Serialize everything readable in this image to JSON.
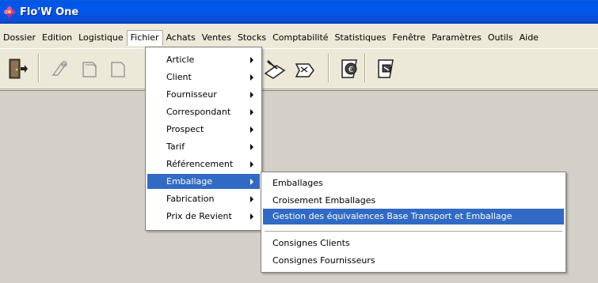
{
  "window": {
    "title": "Flo'W One",
    "app_icon": "flower-app-icon"
  },
  "menubar": {
    "items": [
      "Dossier",
      "Edition",
      "Logistique",
      "Fichier",
      "Achats",
      "Ventes",
      "Stocks",
      "Comptabilité",
      "Statistiques",
      "Fenêtre",
      "Paramètres",
      "Outils",
      "Aide"
    ],
    "active": "Fichier"
  },
  "toolbar": {
    "buttons": [
      "exit-icon",
      "tool-icon-1",
      "tool-icon-2",
      "tool-icon-3",
      "tool-icon-4",
      "tool-icon-5",
      "tool-icon-euro",
      "tool-icon-6"
    ]
  },
  "fichier_menu": {
    "items": [
      "Article",
      "Client",
      "Fournisseur",
      "Correspondant",
      "Prospect",
      "Tarif",
      "Référencement",
      "Emballage",
      "Fabrication",
      "Prix de Revient"
    ],
    "selected": "Emballage"
  },
  "emballage_submenu": {
    "group1": [
      "Emballages",
      "Croisement Emballages",
      "Gestion des équivalences Base Transport et Emballage"
    ],
    "group2": [
      "Consignes Clients",
      "Consignes Fournisseurs"
    ],
    "selected": "Gestion des équivalences Base Transport et Emballage"
  },
  "colors": {
    "title_bar": "#0055e5",
    "selection": "#316ac5",
    "menu_bg": "#ece9d8",
    "workspace": "#d4d0c8"
  }
}
